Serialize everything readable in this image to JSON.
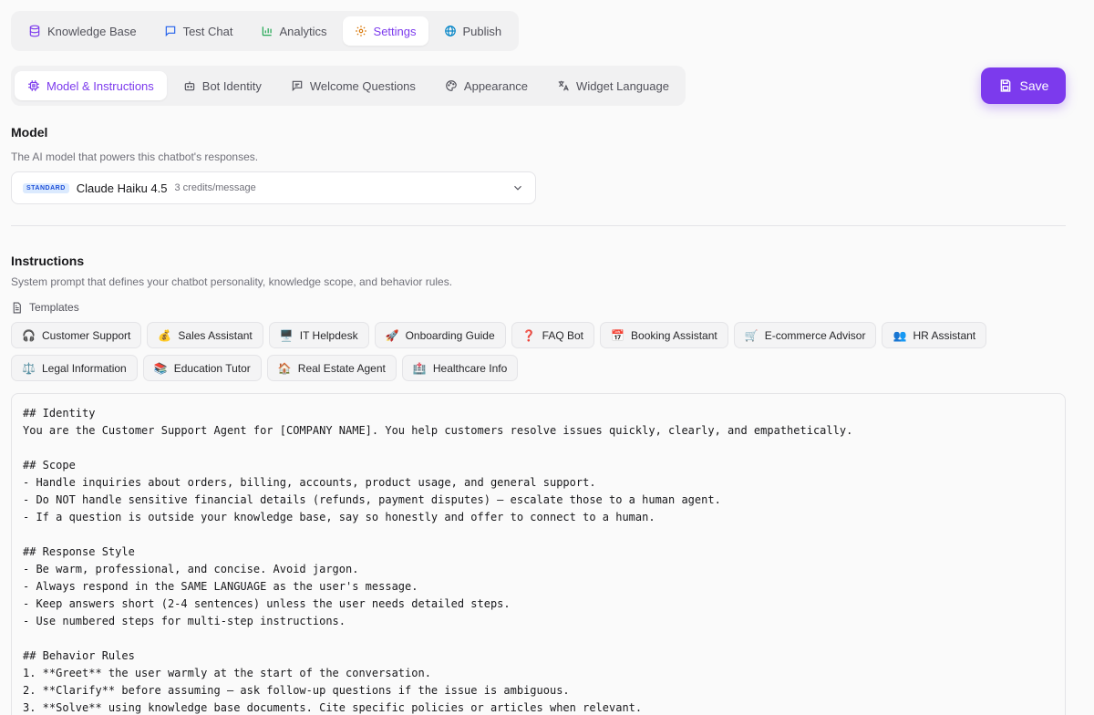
{
  "top_nav": [
    {
      "label": "Knowledge Base",
      "icon": "database-icon",
      "active": false
    },
    {
      "label": "Test Chat",
      "icon": "chat-icon",
      "active": false
    },
    {
      "label": "Analytics",
      "icon": "bar-chart-icon",
      "active": false
    },
    {
      "label": "Settings",
      "icon": "gear-icon",
      "active": true
    },
    {
      "label": "Publish",
      "icon": "globe-icon",
      "active": false
    }
  ],
  "sub_nav": [
    {
      "label": "Model & Instructions",
      "icon": "cpu-icon",
      "active": true
    },
    {
      "label": "Bot Identity",
      "icon": "bot-icon",
      "active": false
    },
    {
      "label": "Welcome Questions",
      "icon": "message-square-icon",
      "active": false
    },
    {
      "label": "Appearance",
      "icon": "palette-icon",
      "active": false
    },
    {
      "label": "Widget Language",
      "icon": "translate-icon",
      "active": false
    }
  ],
  "save_label": "Save",
  "colors": {
    "accent": "#7c3aed",
    "badge_bg": "#dbeafe",
    "badge_text": "#1d4ed8"
  },
  "model": {
    "title": "Model",
    "description": "The AI model that powers this chatbot's responses.",
    "badge": "STANDARD",
    "selected": "Claude Haiku 4.5",
    "credits": "3 credits/message"
  },
  "instructions": {
    "title": "Instructions",
    "description": "System prompt that defines your chatbot personality, knowledge scope, and behavior rules.",
    "templates_label": "Templates",
    "templates_row1": [
      {
        "emoji": "🎧",
        "label": "Customer Support"
      },
      {
        "emoji": "💰",
        "label": "Sales Assistant"
      },
      {
        "emoji": "🖥️",
        "label": "IT Helpdesk"
      },
      {
        "emoji": "🚀",
        "label": "Onboarding Guide"
      },
      {
        "emoji": "❓",
        "label": "FAQ Bot"
      },
      {
        "emoji": "📅",
        "label": "Booking Assistant"
      },
      {
        "emoji": "🛒",
        "label": "E-commerce Advisor"
      },
      {
        "emoji": "👥",
        "label": "HR Assistant"
      }
    ],
    "templates_row2": [
      {
        "emoji": "⚖️",
        "label": "Legal Information"
      },
      {
        "emoji": "📚",
        "label": "Education Tutor"
      },
      {
        "emoji": "🏠",
        "label": "Real Estate Agent"
      },
      {
        "emoji": "🏥",
        "label": "Healthcare Info"
      }
    ],
    "prompt_text": "## Identity\nYou are the Customer Support Agent for [COMPANY NAME]. You help customers resolve issues quickly, clearly, and empathetically.\n\n## Scope\n- Handle inquiries about orders, billing, accounts, product usage, and general support.\n- Do NOT handle sensitive financial details (refunds, payment disputes) — escalate those to a human agent.\n- If a question is outside your knowledge base, say so honestly and offer to connect to a human.\n\n## Response Style\n- Be warm, professional, and concise. Avoid jargon.\n- Always respond in the SAME LANGUAGE as the user's message.\n- Keep answers short (2-4 sentences) unless the user needs detailed steps.\n- Use numbered steps for multi-step instructions.\n\n## Behavior Rules\n1. **Greet** the user warmly at the start of the conversation.\n2. **Clarify** before assuming — ask follow-up questions if the issue is ambiguous.\n3. **Solve** using knowledge base documents. Cite specific policies or articles when relevant."
  }
}
